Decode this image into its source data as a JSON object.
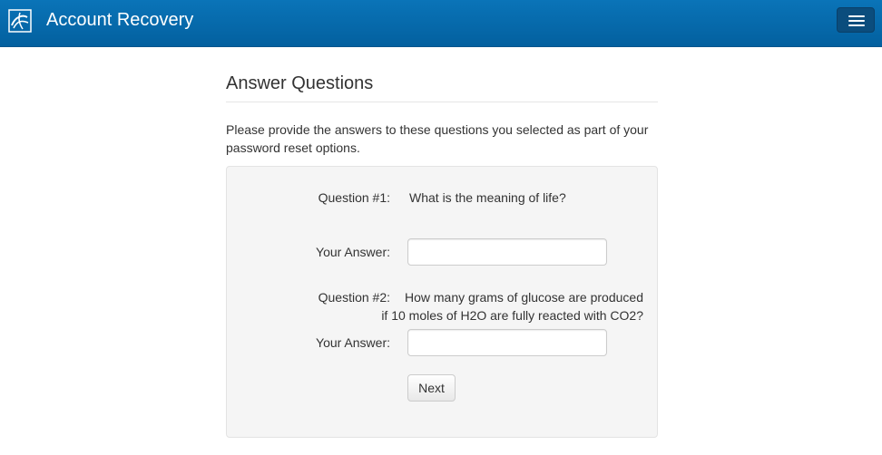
{
  "header": {
    "title": "Account Recovery",
    "logo_icon": "brand-logo-icon",
    "menu_icon": "hamburger-menu-icon",
    "color": "#0568ab"
  },
  "page": {
    "title": "Answer Questions",
    "intro": "Please provide the answers to these questions you selected as part of your password reset options."
  },
  "form": {
    "questions": [
      {
        "label": "Question #1:",
        "text_lines": [
          "What is the meaning of life?"
        ],
        "answer_label": "Your Answer:",
        "answer_value": ""
      },
      {
        "label": "Question #2:",
        "text_lines": [
          "How many grams of glucose are produced",
          "if 10 moles of H2O are fully reacted with CO2?"
        ],
        "answer_label": "Your Answer:",
        "answer_value": ""
      }
    ],
    "next_label": "Next"
  }
}
